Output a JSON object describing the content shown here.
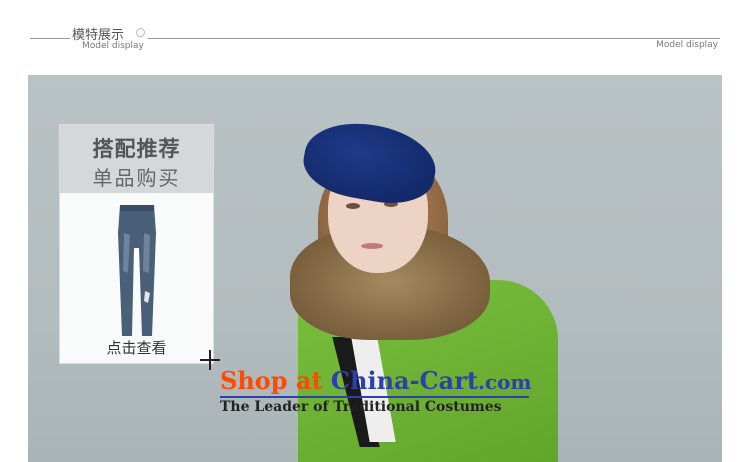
{
  "header": {
    "title": "模特展示",
    "subtitle": "Model display",
    "right_label": "Model display"
  },
  "panel": {
    "title": "搭配推荐",
    "subtitle": "单品购买",
    "cta": "点击查看"
  },
  "watermark": {
    "shop": "Shop at ",
    "site": "China-Cart",
    "domain": ".com",
    "tagline": "The Leader of  Traditional Costumes"
  },
  "colors": {
    "background": "#b7c0c2",
    "coat": "#6bb032",
    "watermark_orange": "#ff4a00",
    "watermark_blue": "#2e3fae"
  }
}
